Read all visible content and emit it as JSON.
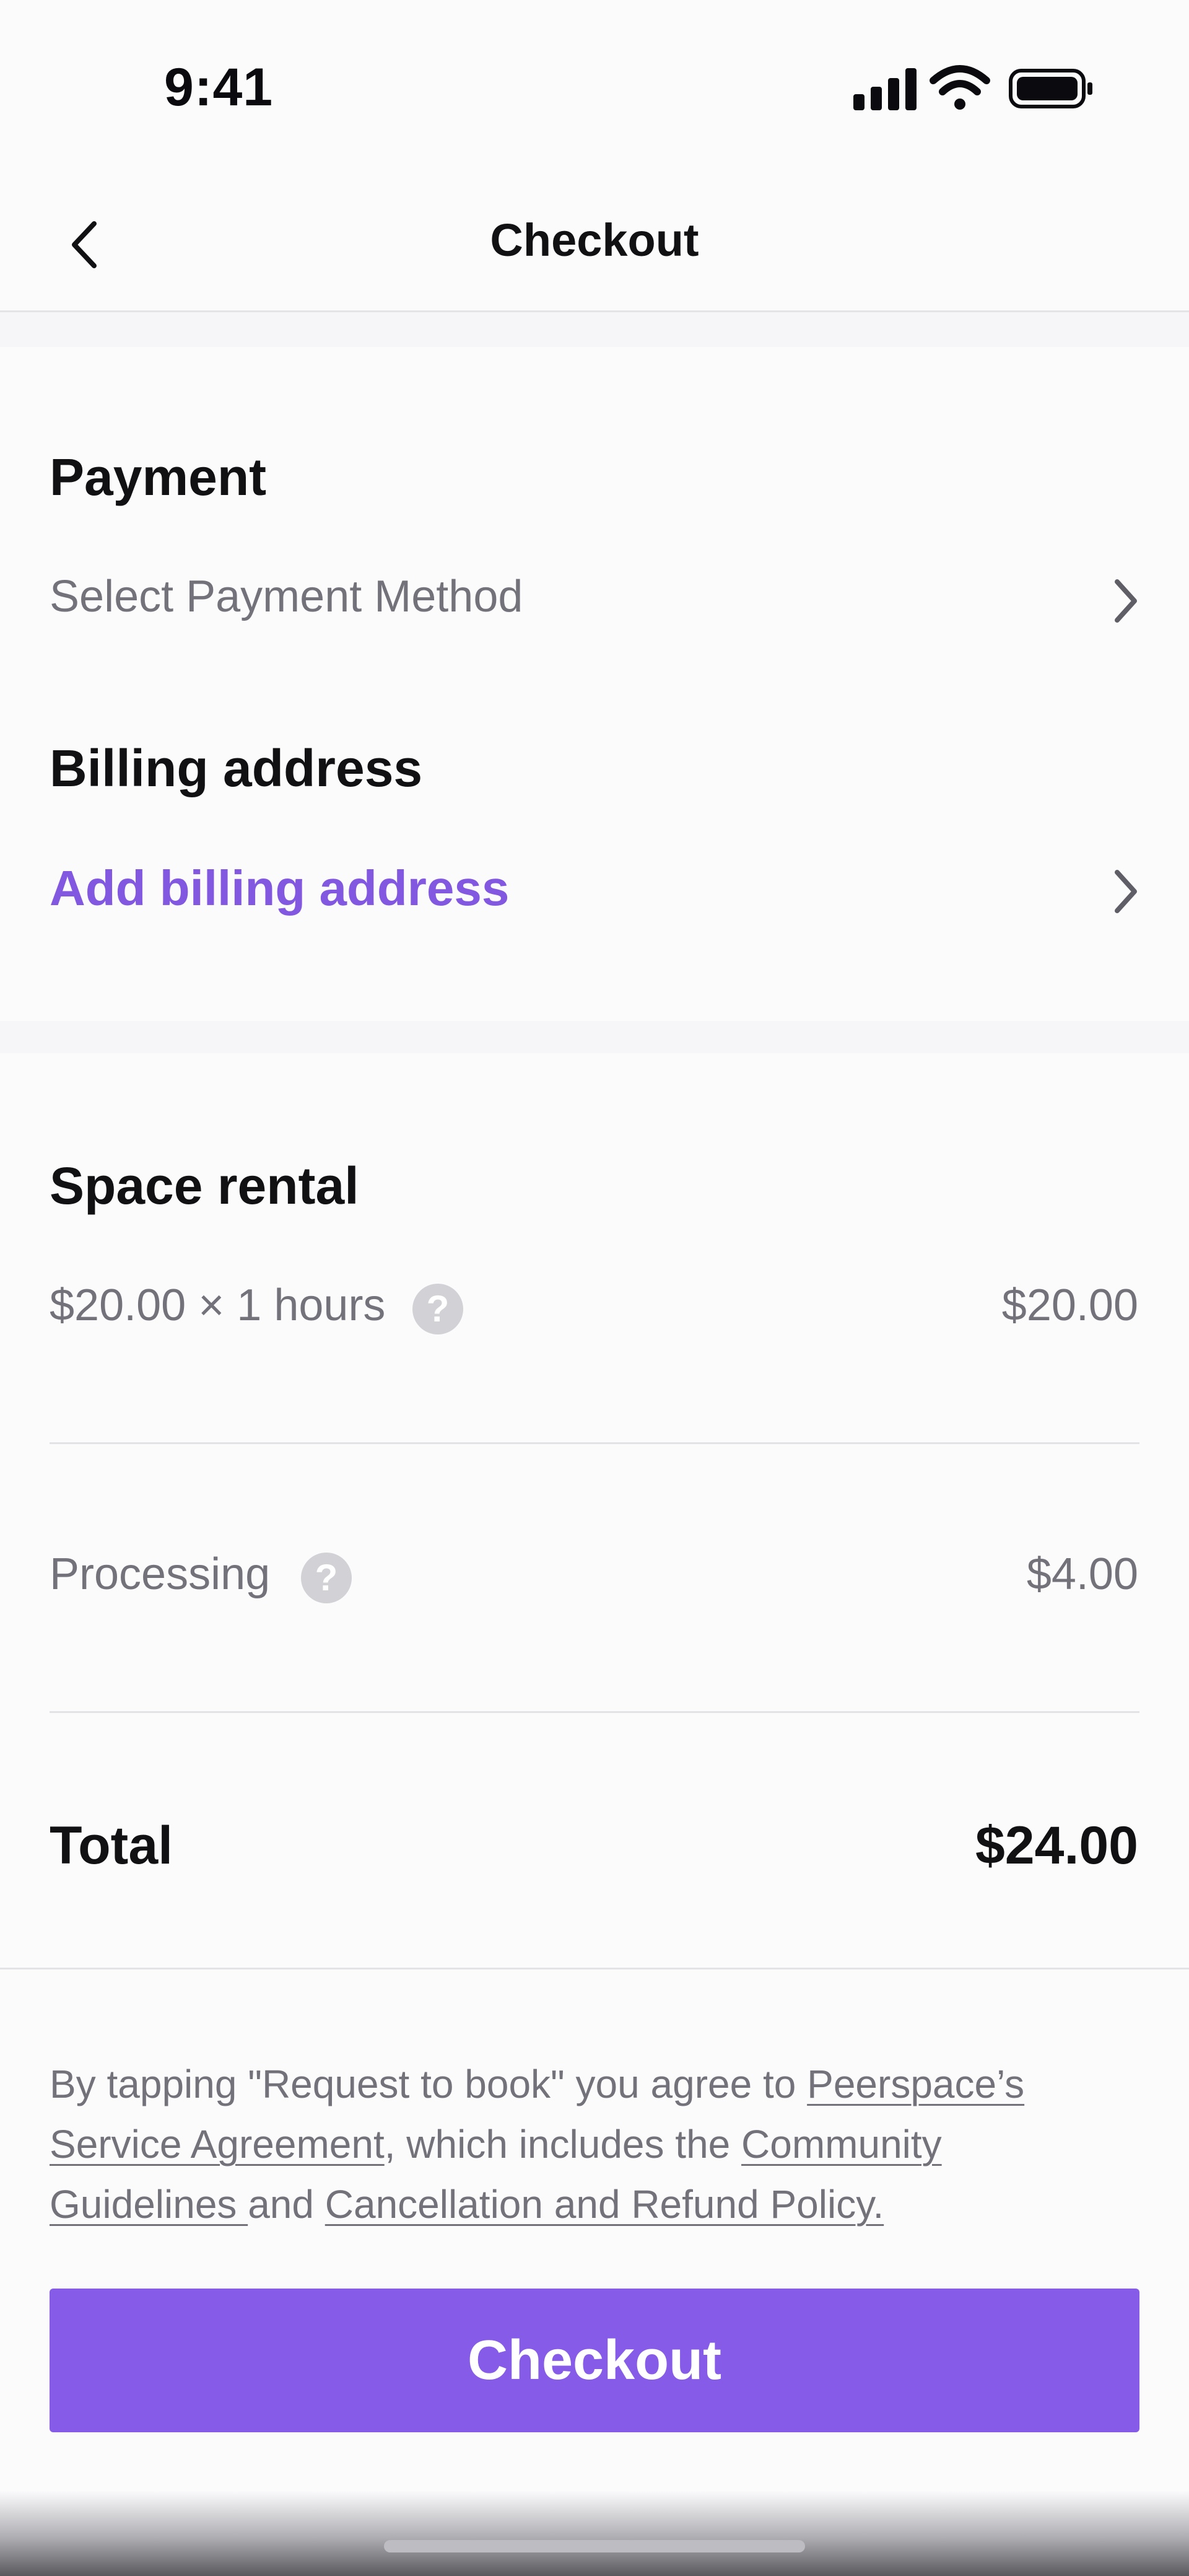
{
  "status_bar": {
    "time": "9:41"
  },
  "nav": {
    "title": "Checkout"
  },
  "payment": {
    "heading": "Payment",
    "method_placeholder": "Select Payment Method"
  },
  "billing": {
    "heading": "Billing address",
    "add_link": "Add billing address"
  },
  "space_rental": {
    "heading": "Space rental",
    "line_label": "$20.00 × 1 hours",
    "line_amount": "$20.00"
  },
  "processing": {
    "label": "Processing",
    "amount": "$4.00"
  },
  "total": {
    "label": "Total",
    "amount": "$24.00"
  },
  "legal": {
    "prefix": "By tapping \"Request to book\" you agree to ",
    "link_agreement": "Peerspace’s Service Agreement",
    "mid": ", which includes the ",
    "link_guidelines": "Community Guidelines ",
    "and": "and ",
    "link_policy": "Cancellation and Refund Policy."
  },
  "help_glyph": "?",
  "checkout_button": {
    "label": "Checkout"
  },
  "colors": {
    "accent": "#855be8",
    "link": "#8258e0",
    "muted_text": "#73727b",
    "help_icon_bg": "#d2d1d6"
  },
  "icons": {
    "back": "chevron-left-icon",
    "row_arrow": "chevron-right-icon",
    "help": "question-circle-icon",
    "signal": "cellular-signal-icon",
    "wifi": "wifi-icon",
    "battery": "battery-icon"
  }
}
